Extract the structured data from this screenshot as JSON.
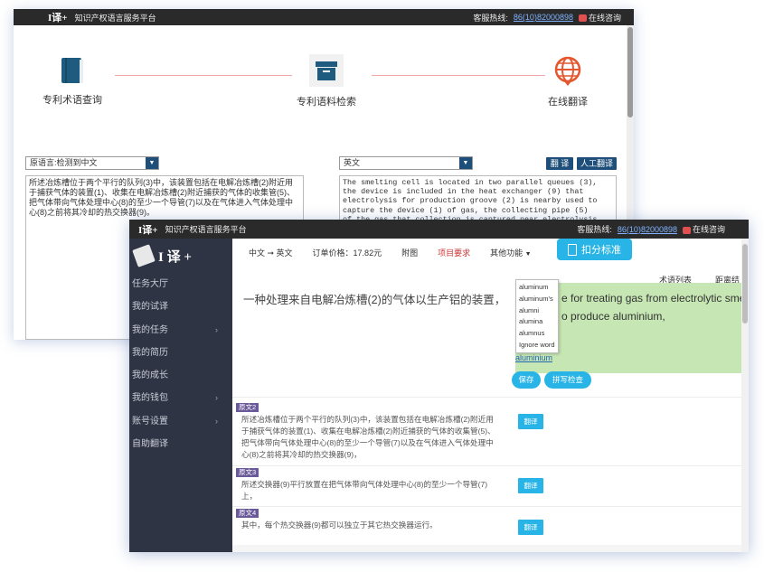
{
  "back_window": {
    "brand": "I译+",
    "platform_name": "知识产权语言服务平台",
    "hotline_label": "客服热线:",
    "hotline_number": "86(10)82000898",
    "online_chat": "在线咨询",
    "features": [
      {
        "label": "专利术语查询",
        "icon": "book-icon"
      },
      {
        "label": "专利语料检索",
        "icon": "archive-box-icon"
      },
      {
        "label": "在线翻译",
        "icon": "globe-icon"
      }
    ],
    "source_lang": "原语言:检测到中文",
    "target_lang": "英文",
    "translate_button": "翻 译",
    "human_translate_button": "人工翻译",
    "source_text": "所述冶炼槽位于两个平行的队列(3)中，该装置包括在电解冶炼槽(2)附近用于捕获气体的装置(1)、收集在电解冶炼槽(2)附近捕获的气体的收集管(5)、把气体带向气体处理中心(8)的至少一个导管(7)以及在气体进入气体处理中心(8)之前将其冷却的热交换器(9)。",
    "target_lines": [
      "The smelting cell is located in two parallel queues (3),",
      "the device is included in the heat exchanger (9) that",
      "electrolysis for production groove (2) is nearby used to",
      "capture the device (1) of gas, the collecting pipe (5)",
      "of the gas that collection is captured near electrolysis"
    ]
  },
  "front_window": {
    "brand": "I译+",
    "platform_name": "知识产权语言服务平台",
    "hotline_label": "客服热线:",
    "hotline_number": "86(10)82000898",
    "online_chat": "在线咨询",
    "sidebar": {
      "logo_text": "I 译 +",
      "items": [
        {
          "label": "任务大厅",
          "chevron": false
        },
        {
          "label": "我的试译",
          "chevron": false
        },
        {
          "label": "我的任务",
          "chevron": true
        },
        {
          "label": "我的简历",
          "chevron": false
        },
        {
          "label": "我的成长",
          "chevron": false
        },
        {
          "label": "我的钱包",
          "chevron": true
        },
        {
          "label": "账号设置",
          "chevron": true
        },
        {
          "label": "自助翻译",
          "chevron": false
        }
      ]
    },
    "tabs": {
      "lang_pair": "中文 ➞ 英文",
      "order_price": "订单价格：17.82元",
      "figures": "附图",
      "project_req": "项目要求",
      "other": "其他功能"
    },
    "deduct_button": "扣分标准",
    "term_list": "术语列表",
    "distance": "距离结",
    "segment1": {
      "source": "一种处理来自电解冶炼槽(2)的气体以生产铝的装置，",
      "target_line1": "e for treating gas from electrolytic sme",
      "target_line2": "o produce aluminium,",
      "suggestions": [
        "aluminum",
        "aluminum's",
        "alumni",
        "alumina",
        "alumnus",
        "Ignore word"
      ],
      "current_word": "aluminium",
      "save_button": "保存",
      "spell_button": "拼写检查"
    },
    "segments": [
      {
        "badge": "原文2",
        "text": "所述冶炼槽位于两个平行的队列(3)中，该装置包括在电解冶炼槽(2)附近用于捕获气体的装置(1)、收集在电解冶炼槽(2)附近捕获的气体的收集管(5)、把气体带向气体处理中心(8)的至少一个导管(7)以及在气体进入气体处理中心(8)之前将其冷却的热交换器(9)，",
        "button": "翻译"
      },
      {
        "badge": "原文3",
        "text": "所述交换器(9)平行放置在把气体带向气体处理中心(8)的至少一个导管(7)上，",
        "button": "翻译"
      },
      {
        "badge": "原文4",
        "text": "其中，每个热交换器(9)都可以独立于其它热交换器运行。",
        "button": "翻译"
      }
    ]
  }
}
